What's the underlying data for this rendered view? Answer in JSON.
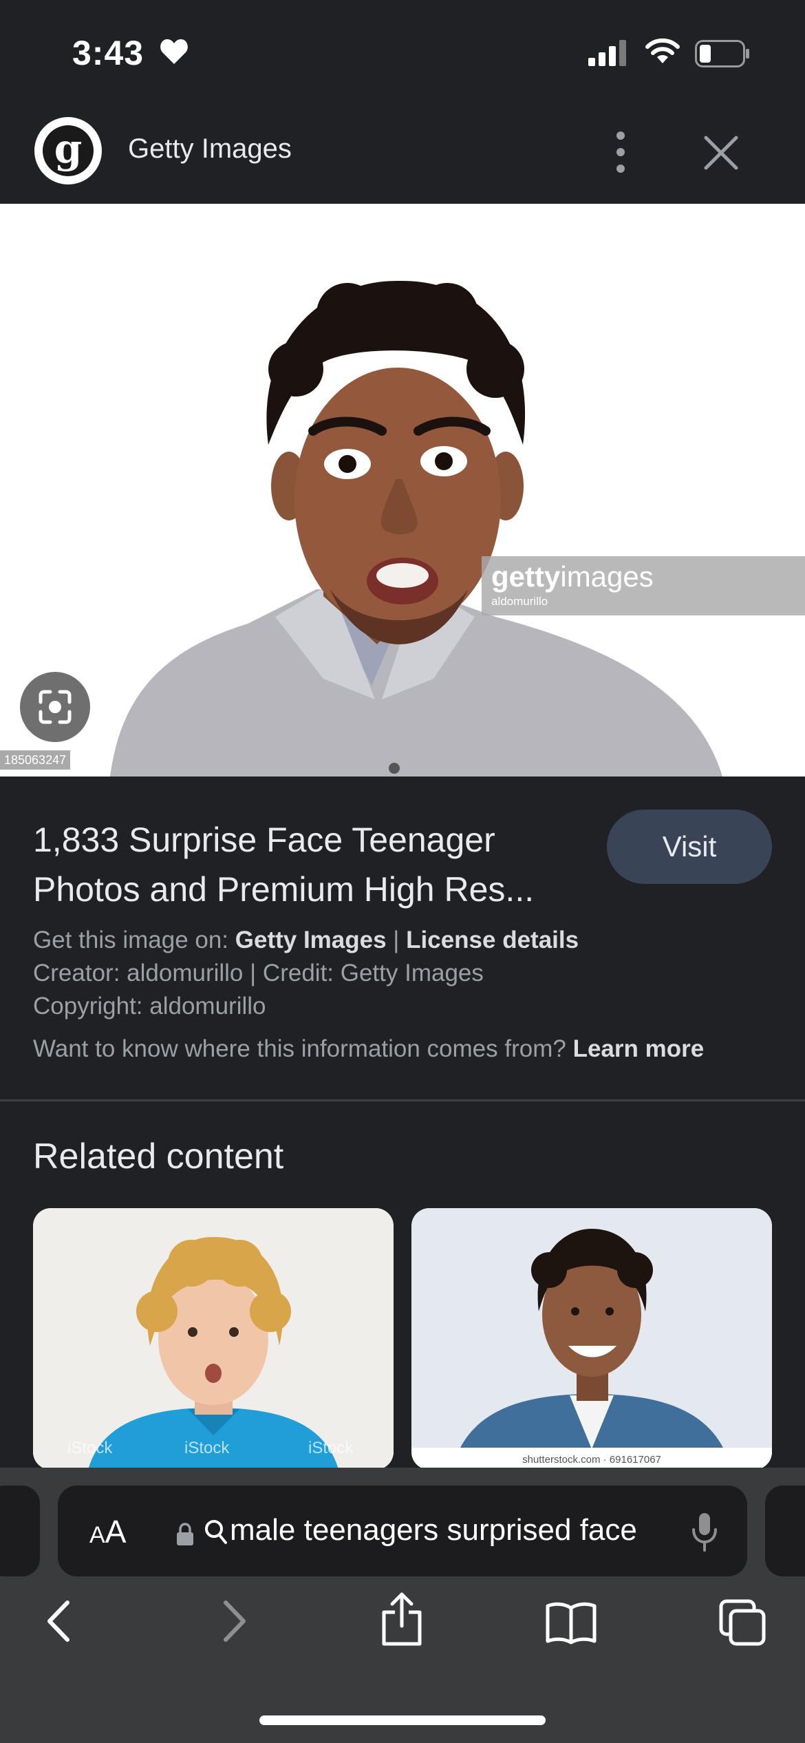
{
  "status_bar": {
    "time": "3:43"
  },
  "header": {
    "logo_letter": "g",
    "site_name": "Getty Images"
  },
  "image": {
    "watermark_brand_bold": "getty",
    "watermark_brand_light": "images",
    "watermark_credit": "aldomurillo",
    "image_id": "185063247"
  },
  "result": {
    "title_line1": "1,833 Surprise Face Teenager",
    "title_line2": "Photos and Premium High Res...",
    "visit_label": "Visit",
    "get_image_prefix": "Get this image on: ",
    "get_image_source": "Getty Images",
    "separator": " | ",
    "license_label": "License details",
    "creator_line": "Creator: aldomurillo | Credit: Getty Images",
    "copyright_line": "Copyright: aldomurillo",
    "info_question": "Want to know where this information comes from? ",
    "learn_more": "Learn more"
  },
  "related": {
    "title": "Related content",
    "cards": [
      {
        "watermark": "iStock"
      },
      {
        "caption": "shutterstock.com · 691617067"
      }
    ]
  },
  "toolbar": {
    "aa_small": "A",
    "aa_big": "A",
    "address_text": "male teenagers surprised face"
  }
}
